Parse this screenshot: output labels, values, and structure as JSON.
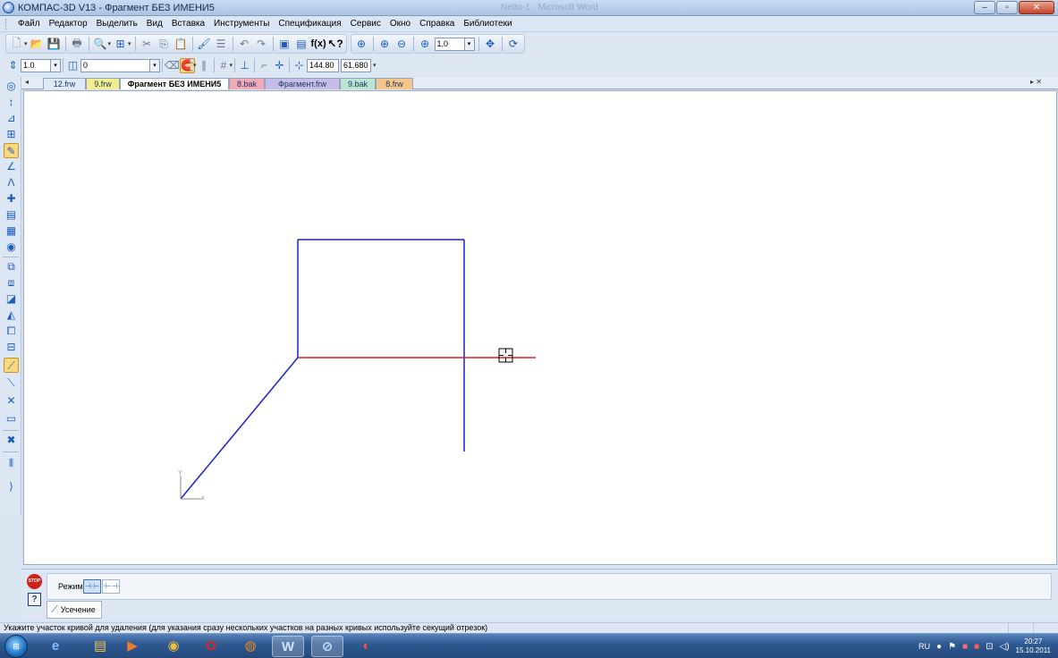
{
  "window": {
    "title": "КОМПАС-3D V13 - Фрагмент БЕЗ ИМЕНИ5",
    "ghost_title": "Netto-1 · Microsoft Word",
    "controls": {
      "minimize": "–",
      "maximize": "▫",
      "close": "✕"
    }
  },
  "menu": [
    "Файл",
    "Редактор",
    "Выделить",
    "Вид",
    "Вставка",
    "Инструменты",
    "Спецификация",
    "Сервис",
    "Окно",
    "Справка",
    "Библиотеки"
  ],
  "toolbar1": {
    "zoom_value": "1.0"
  },
  "toolbar2": {
    "step_value": "1.0",
    "layer_value": "0",
    "coord_x": "144.80",
    "coord_y": "61.680"
  },
  "tabs": [
    {
      "label": "12.frw",
      "color": "#dfe9f8"
    },
    {
      "label": "9.frw",
      "color": "#f3ee8c"
    },
    {
      "label": "Фрагмент БЕЗ ИМЕНИ5",
      "color": "#ffffff",
      "active": true
    },
    {
      "label": "8.bak",
      "color": "#f4a9b7"
    },
    {
      "label": "Фрагмент.frw",
      "color": "#c5bde8"
    },
    {
      "label": "9.bak",
      "color": "#b9e5d1"
    },
    {
      "label": "8.frw",
      "color": "#f6c58c"
    }
  ],
  "tabs_nav": {
    "prev": "◂",
    "close": "▸ ✕"
  },
  "drawing": {
    "blue_color": "#1a22c8",
    "red_color": "#e0201a",
    "axis_x_label": "x",
    "axis_y_label": "Y"
  },
  "properties": {
    "stop_label": "STOP",
    "help_label": "?",
    "mode_label": "Режим",
    "tab_label": "Усечение"
  },
  "status": {
    "message": "Укажите участок кривой для удаления (для указания сразу нескольких участков на разных кривых используйте секущий отрезок)"
  },
  "taskbar": {
    "language": "RU",
    "time": "20:27",
    "date": "15.10.2011"
  }
}
